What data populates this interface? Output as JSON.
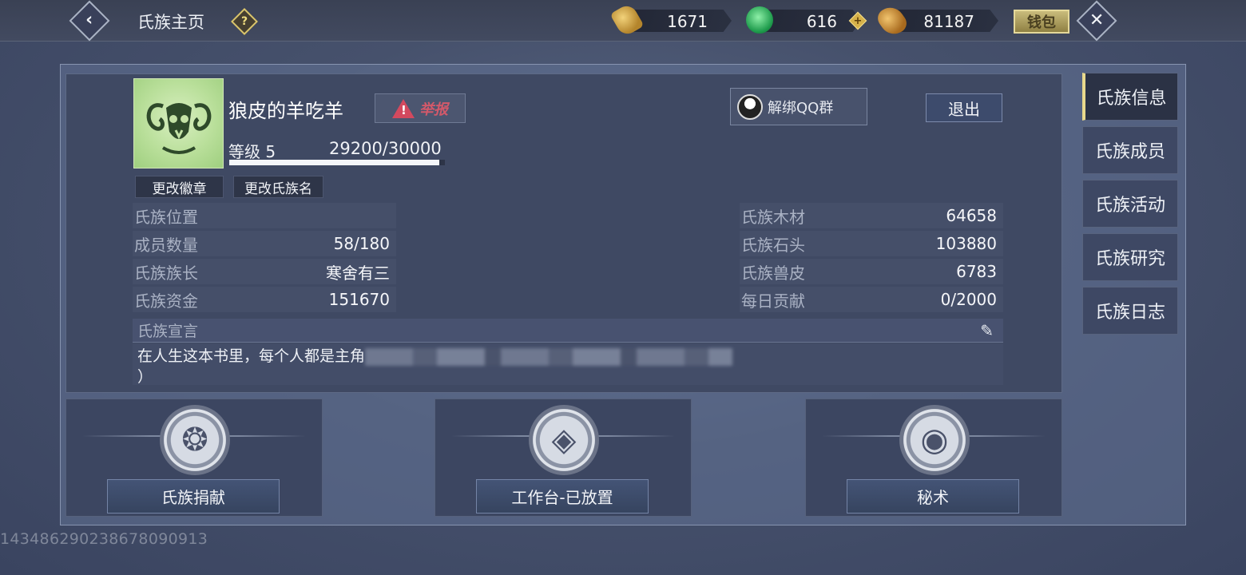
{
  "topbar": {
    "title": "氏族主页",
    "help": "?",
    "currencies": [
      {
        "icon": "gold-bell-icon",
        "value": "1671"
      },
      {
        "icon": "jade-icon",
        "value": "616"
      },
      {
        "icon": "feather-coin-icon",
        "value": "81187"
      }
    ],
    "add_label": "+",
    "wallet_label": "钱包"
  },
  "clan": {
    "name": "狼皮的羊吃羊",
    "report_label": "举报",
    "qq_label": "解绑QQ群",
    "logout_label": "退出",
    "level_label": "等级 5",
    "exp_text": "29200/30000",
    "exp_fraction": 0.973,
    "change_badge_label": "更改徽章",
    "rename_label": "更改氏族名"
  },
  "stats_left": [
    {
      "label": "氏族位置",
      "value": ""
    },
    {
      "label": "成员数量",
      "value": "58/180"
    },
    {
      "label": "氏族族长",
      "value": "寒舍有三"
    },
    {
      "label": "氏族资金",
      "value": "151670"
    }
  ],
  "stats_right": [
    {
      "label": "氏族木材",
      "value": "64658"
    },
    {
      "label": "氏族石头",
      "value": "103880"
    },
    {
      "label": "氏族兽皮",
      "value": "6783"
    },
    {
      "label": "每日贡献",
      "value": "0/2000"
    }
  ],
  "declaration": {
    "title": "氏族宣言",
    "text": "在人生这本书里，每个人都是主角",
    "text_end": "）"
  },
  "actions": [
    {
      "label": "氏族捐献"
    },
    {
      "label": "工作台-已放置"
    },
    {
      "label": "秘术"
    }
  ],
  "sidebar": [
    {
      "label": "氏族信息"
    },
    {
      "label": "氏族成员"
    },
    {
      "label": "氏族活动"
    },
    {
      "label": "氏族研究"
    },
    {
      "label": "氏族日志"
    }
  ],
  "uid": "143486290238678090913",
  "colors": {
    "accent": "#e9d98c",
    "report": "#d3596a",
    "panel": "#3f4963"
  }
}
